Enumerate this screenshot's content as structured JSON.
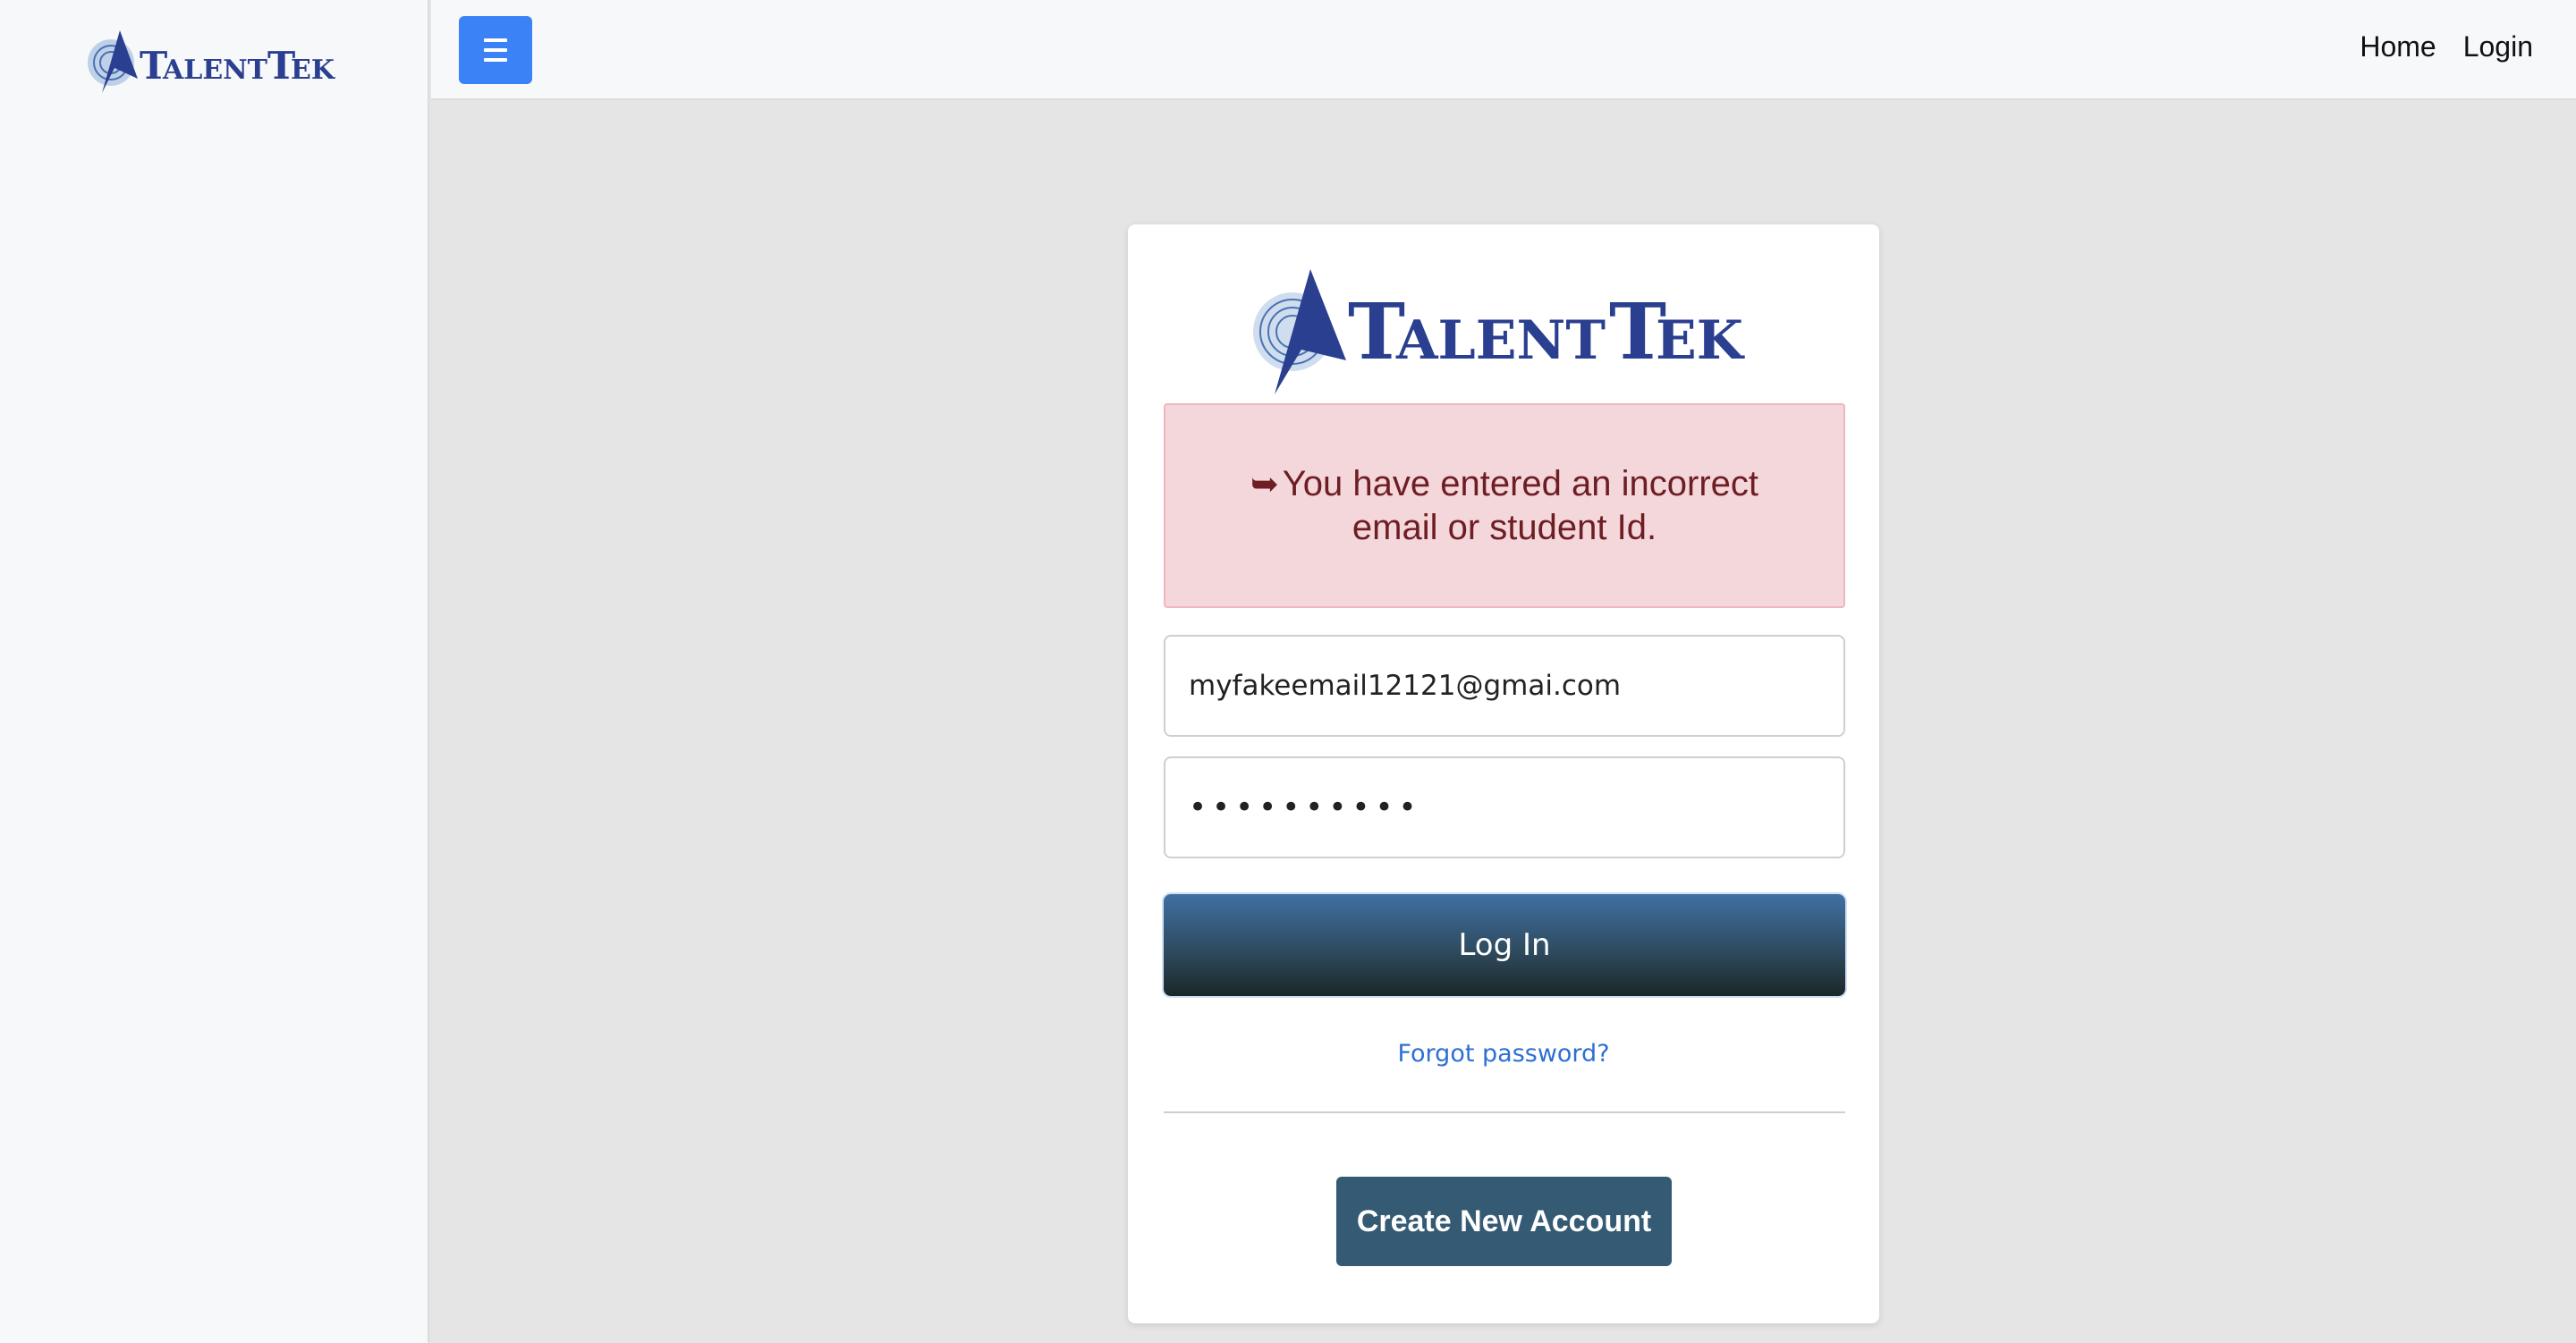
{
  "brand": {
    "logo_text": "TalentTek",
    "primary_color": "#2a3f8f",
    "accent_color": "#3b82f6"
  },
  "topbar": {
    "menu_icon": "hamburger-icon",
    "nav": [
      {
        "label": "Home"
      },
      {
        "label": "Login"
      }
    ]
  },
  "alert": {
    "icon": "arrow-right-icon",
    "glyph": "➥",
    "message": "You have entered an incorrect email or student Id."
  },
  "form": {
    "email_value": "myfakeemail12121@gmai.com",
    "password_value": "••••••••••",
    "login_label": "Log In",
    "forgot_label": "Forgot password?",
    "create_label": "Create New Account"
  }
}
